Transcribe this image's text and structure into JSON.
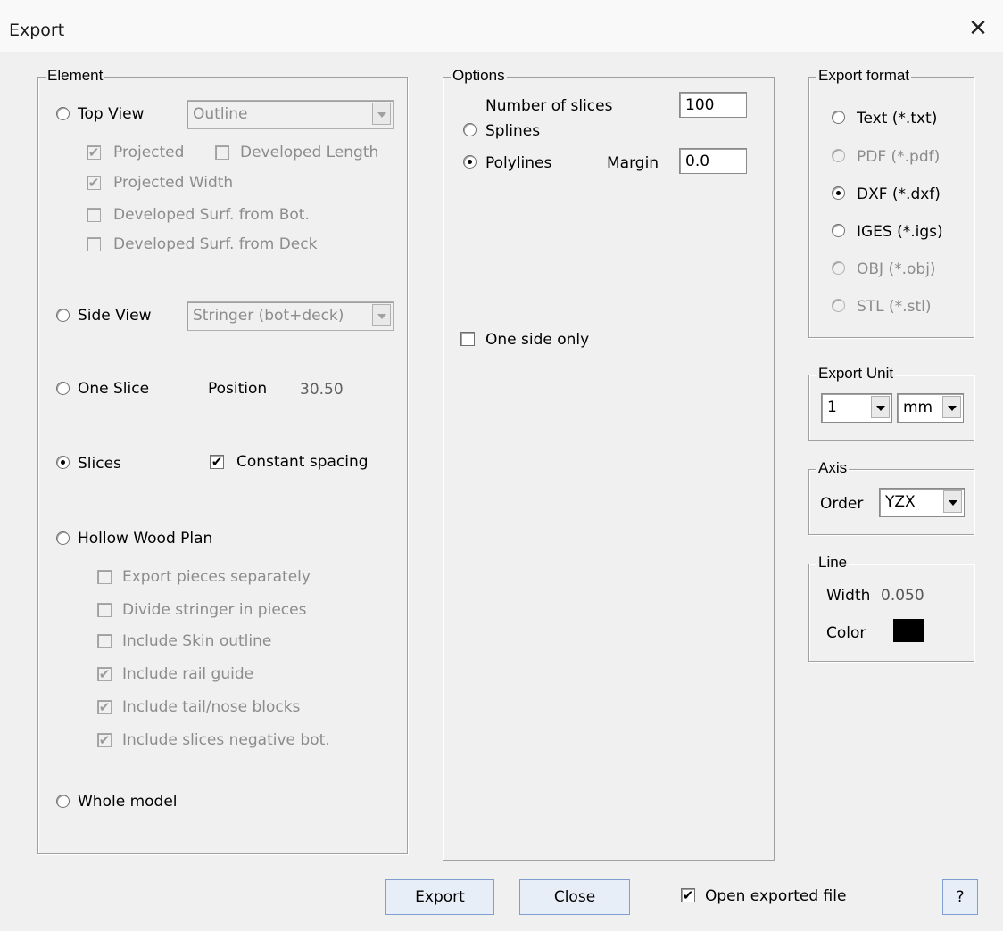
{
  "window": {
    "title": "Export"
  },
  "element": {
    "legend": "Element",
    "top_view": {
      "label": "Top View",
      "combo": "Outline"
    },
    "projected": "Projected",
    "developed_length": "Developed Length",
    "projected_width": "Projected Width",
    "dev_surf_bot": "Developed Surf. from Bot.",
    "dev_surf_deck": "Developed Surf. from Deck",
    "side_view": {
      "label": "Side View",
      "combo": "Stringer (bot+deck)"
    },
    "one_slice": {
      "label": "One Slice",
      "position_label": "Position",
      "position_value": "30.50"
    },
    "slices": {
      "label": "Slices",
      "constant_spacing": "Constant spacing"
    },
    "hollow": {
      "label": "Hollow Wood Plan",
      "opts": [
        "Export pieces separately",
        "Divide stringer in pieces",
        "Include Skin outline",
        "Include rail guide",
        "Include tail/nose blocks",
        "Include slices negative bot."
      ]
    },
    "whole_model": "Whole model"
  },
  "options": {
    "legend": "Options",
    "num_slices_label": "Number of slices",
    "num_slices_value": "100",
    "splines": "Splines",
    "polylines": "Polylines",
    "margin_label": "Margin",
    "margin_value": "0.0",
    "one_side_only": "One side only"
  },
  "format": {
    "legend": "Export format",
    "items": [
      "Text (*.txt)",
      "PDF (*.pdf)",
      "DXF (*.dxf)",
      "IGES (*.igs)",
      "OBJ (*.obj)",
      "STL (*.stl)"
    ]
  },
  "unit": {
    "legend": "Export Unit",
    "scale": "1",
    "unit": "mm"
  },
  "axis": {
    "legend": "Axis",
    "order_label": "Order",
    "order_value": "YZX"
  },
  "line": {
    "legend": "Line",
    "width_label": "Width",
    "width_value": "0.050",
    "color_label": "Color",
    "color_value": "#000000"
  },
  "footer": {
    "export": "Export",
    "close": "Close",
    "open_exported": "Open exported file",
    "help": "?"
  },
  "check_mark": "✔"
}
